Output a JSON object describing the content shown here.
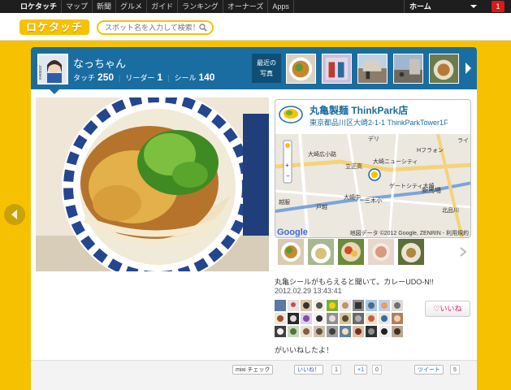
{
  "topnav": {
    "items": [
      "ロケタッチ",
      "マップ",
      "新聞",
      "グルメ",
      "ガイド",
      "ランキング",
      "オーナーズ",
      "Apps"
    ],
    "home_label": "ホーム",
    "notification_count": "1"
  },
  "header": {
    "logo_text": "ロケタッチ",
    "search_placeholder": "スポット名を入力して検索！"
  },
  "profile": {
    "name": "なっちゃん",
    "avatar_text": "livedoor",
    "touch_label": "タッチ",
    "touch_count": "250",
    "leader_label": "リーダー",
    "leader_count": "1",
    "seal_label": "シール",
    "seal_count": "140",
    "recent_label_1": "最近の",
    "recent_label_2": "写真"
  },
  "shop": {
    "name": "丸亀製麺 ThinkPark店",
    "address": "東京都品川区大崎2-1-1 ThinkParkTower1F",
    "map_credit": "地図データ ©2012 Google, ZENRIN - 利用規約",
    "google_logo": "Google",
    "map_labels": [
      "大崎広小路",
      "立正高",
      "大崎ニューシティ",
      "ゲートシティ大崎",
      "新馬場",
      "越服",
      "戸越",
      "大崎中",
      "三木小",
      "北品川",
      "Hフラォン",
      "ライ",
      "デリ"
    ]
  },
  "post": {
    "caption": "丸亀シールがもらえると聞いて。カレーUDO-N!!",
    "timestamp": "2012.02.29 13:43:41",
    "like_button": "いいね",
    "liked_text": "がいいねしたよ！"
  },
  "share": {
    "mixi_label": "mixi チェック",
    "fb_label": "いいね！",
    "fb_count": "1",
    "gplus_label": "+1",
    "gplus_count": "0",
    "tweet_label": "ツイート",
    "tweet_count": "5"
  },
  "colors": {
    "brand_yellow": "#f6c200",
    "profile_blue": "#1a6da0",
    "like_pink": "#d9246f"
  }
}
